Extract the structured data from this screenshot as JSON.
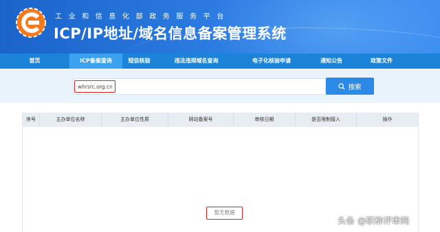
{
  "header": {
    "subtitle": "工业和信息化部政务服务平台",
    "title": "ICP/IP地址/域名信息备案管理系统",
    "logo_icon": "miit-logo-icon"
  },
  "nav": {
    "items": [
      {
        "label": "首页",
        "active": false
      },
      {
        "label": "ICP备案查询",
        "active": true
      },
      {
        "label": "短信核验",
        "active": false
      },
      {
        "label": "违法违规域名查询",
        "active": false
      },
      {
        "label": "电子化核验申请",
        "active": false
      },
      {
        "label": "通知公告",
        "active": false
      },
      {
        "label": "政策文件",
        "active": false
      }
    ]
  },
  "search": {
    "value": "whrsrc.org.cn",
    "button_label": "搜索",
    "button_icon": "search-icon"
  },
  "table": {
    "columns": [
      "序号",
      "主办单位名称",
      "主办单位性质",
      "网站备案号",
      "审核日期",
      "是否限制接入",
      "操作"
    ],
    "empty_text": "暂无数据"
  },
  "watermark": "头条 @职称评审网",
  "colors": {
    "banner": "#1a63c9",
    "nav": "#1c84d8",
    "nav_active": "#3aa2ef",
    "search_button": "#2b8ae6",
    "highlight_border": "#e02020"
  }
}
